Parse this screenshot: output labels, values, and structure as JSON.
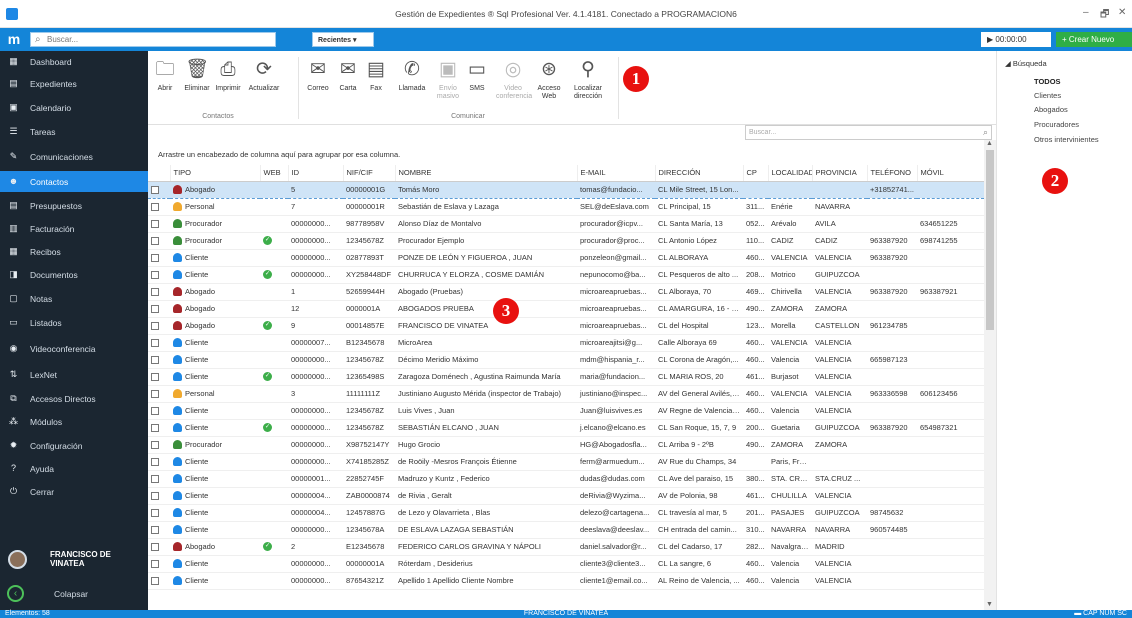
{
  "window": {
    "title": "Gestión de Expedientes ® Sql Profesional Ver. 4.1.4181. Conectado a PROGRAMACION6",
    "min": "–",
    "max": "🗗",
    "close": "✕"
  },
  "topbar": {
    "search_placeholder": "Buscar...",
    "recent_label": "Recientes",
    "timer": "▶ 00:00:00",
    "create_label": "+ Crear Nuevo"
  },
  "sidebar": {
    "items": [
      {
        "label": "Dashboard",
        "icon": "▦"
      },
      {
        "label": "Expedientes",
        "icon": "▤"
      },
      {
        "label": "Calendario",
        "icon": "▣"
      },
      {
        "label": "Tareas",
        "icon": "☰"
      },
      {
        "label": "Comunicaciones",
        "icon": "✎"
      },
      {
        "label": "Contactos",
        "icon": "☻"
      },
      {
        "label": "Presupuestos",
        "icon": "▤"
      },
      {
        "label": "Facturación",
        "icon": "▥"
      },
      {
        "label": "Recibos",
        "icon": "▦"
      },
      {
        "label": "Documentos",
        "icon": "◨"
      },
      {
        "label": "Notas",
        "icon": "▢"
      },
      {
        "label": "Listados",
        "icon": "▭"
      },
      {
        "label": "Videoconferencia",
        "icon": "◉"
      },
      {
        "label": "LexNet",
        "icon": "⇅"
      },
      {
        "label": "Accesos Directos",
        "icon": "⧉"
      },
      {
        "label": "Módulos",
        "icon": "⁂"
      },
      {
        "label": "Configuración",
        "icon": "✹"
      },
      {
        "label": "Ayuda",
        "icon": "?"
      },
      {
        "label": "Cerrar",
        "icon": "⏻"
      }
    ],
    "active_index": 5,
    "user_name": "FRANCISCO DE VINATEA",
    "collapse_label": "Colapsar"
  },
  "ribbon": {
    "contactos_buttons": [
      {
        "label": "Abrir",
        "icon": "🗀"
      },
      {
        "label": "Eliminar",
        "icon": "🗑"
      },
      {
        "label": "Imprimir",
        "icon": "⎙"
      },
      {
        "label": "Actualizar",
        "icon": "⟳"
      }
    ],
    "contactos_group": "Contactos",
    "comunicar_buttons": [
      {
        "label": "Correo",
        "icon": "✉",
        "disabled": false
      },
      {
        "label": "Carta",
        "icon": "✉",
        "disabled": false
      },
      {
        "label": "Fax",
        "icon": "▤",
        "disabled": false
      },
      {
        "label": "Llamada",
        "icon": "✆",
        "disabled": false
      },
      {
        "label": "Envío masivo",
        "icon": "▣",
        "disabled": true
      },
      {
        "label": "SMS",
        "icon": "▭",
        "disabled": false
      },
      {
        "label": "Video conferencia",
        "icon": "◎",
        "disabled": true
      },
      {
        "label": "Acceso Web",
        "icon": "⊛",
        "disabled": false
      },
      {
        "label": "Localizar dirección",
        "icon": "⚲",
        "disabled": false
      }
    ],
    "comunicar_group": "Comunicar"
  },
  "annotations": [
    "1",
    "2",
    "3"
  ],
  "grid": {
    "search_placeholder": "Buscar...",
    "group_hint": "Arrastre un encabezado de columna aquí para agrupar por esa columna.",
    "columns": [
      "TIPO",
      "WEB",
      "ID",
      "NIF/CIF",
      "NOMBRE",
      "E-MAIL",
      "DIRECCIÓN",
      "CP",
      "LOCALIDAD",
      "PROVINCIA",
      "TELÉFONO",
      "MÓVIL"
    ],
    "rows": [
      {
        "tipo": "Abogado",
        "web": false,
        "id": "5",
        "nif": "00000001G",
        "nombre": "Tomás Moro",
        "email": "tomas@fundacio...",
        "dir": "CL Mile Street, 15 Lon...",
        "cp": "",
        "loc": "",
        "prov": "",
        "tel": "+31852741...",
        "movil": ""
      },
      {
        "tipo": "Personal",
        "web": false,
        "id": "7",
        "nif": "00000001R",
        "nombre": "Sebastián de Eslava y Lazaga",
        "email": "SEL@deEslava.com",
        "dir": "CL Principal, 15",
        "cp": "311...",
        "loc": "Enérie",
        "prov": "NAVARRA",
        "tel": "",
        "movil": ""
      },
      {
        "tipo": "Procurador",
        "web": false,
        "id": "00000000...",
        "nif": "98778958V",
        "nombre": "Alonso Díaz de Montalvo",
        "email": "procurador@icpv...",
        "dir": "CL Santa María, 13",
        "cp": "052...",
        "loc": "Arévalo",
        "prov": "AVILA",
        "tel": "",
        "movil": "634651225"
      },
      {
        "tipo": "Procurador",
        "web": true,
        "id": "00000000...",
        "nif": "12345678Z",
        "nombre": "Procurador Ejemplo",
        "email": "procurador@proc...",
        "dir": "CL Antonio López",
        "cp": "110...",
        "loc": "CADIZ",
        "prov": "CADIZ",
        "tel": "963387920",
        "movil": "698741255"
      },
      {
        "tipo": "Cliente",
        "web": false,
        "id": "00000000...",
        "nif": "02877893T",
        "nombre": "PONZE DE LEÓN Y FIGUEROA , JUAN",
        "email": "ponzeleon@gmail...",
        "dir": "CL ALBORAYA",
        "cp": "460...",
        "loc": "VALENCIA",
        "prov": "VALENCIA",
        "tel": "963387920",
        "movil": ""
      },
      {
        "tipo": "Cliente",
        "web": true,
        "id": "00000000...",
        "nif": "XY258448DF",
        "nombre": "CHURRUCA Y ELORZA , COSME DAMIÁN",
        "email": "nepunocomo@ba...",
        "dir": "CL Pesqueros de alto ...",
        "cp": "208...",
        "loc": "Motrico",
        "prov": "GUIPUZCOA",
        "tel": "",
        "movil": ""
      },
      {
        "tipo": "Abogado",
        "web": false,
        "id": "1",
        "nif": "52659944H",
        "nombre": "Abogado (Pruebas)",
        "email": "microareapruebas...",
        "dir": "CL Alboraya, 70",
        "cp": "469...",
        "loc": "Chirivella",
        "prov": "VALENCIA",
        "tel": "963387920",
        "movil": "963387921"
      },
      {
        "tipo": "Abogado",
        "web": false,
        "id": "12",
        "nif": "0000001A",
        "nombre": "ABOGADOS PRUEBA",
        "email": "microareapruebas...",
        "dir": "CL AMARGURA, 16 - 1...",
        "cp": "490...",
        "loc": "ZAMORA",
        "prov": "ZAMORA",
        "tel": "",
        "movil": ""
      },
      {
        "tipo": "Abogado",
        "web": true,
        "id": "9",
        "nif": "00014857E",
        "nombre": "FRANCISCO DE VINATEA",
        "email": "microareapruebas...",
        "dir": "CL del Hospital",
        "cp": "123...",
        "loc": "Morella",
        "prov": "CASTELLON",
        "tel": "961234785",
        "movil": ""
      },
      {
        "tipo": "Cliente",
        "web": false,
        "id": "00000007...",
        "nif": "B12345678",
        "nombre": "MicroArea",
        "email": "microareajitsi@g...",
        "dir": "Calle Alboraya 69",
        "cp": "460...",
        "loc": "VALENCIA",
        "prov": "VALENCIA",
        "tel": "",
        "movil": ""
      },
      {
        "tipo": "Cliente",
        "web": false,
        "id": "00000000...",
        "nif": "12345678Z",
        "nombre": "Décimo Meridio Máximo",
        "email": "mdm@hispania_r...",
        "dir": "CL Corona de Aragón,...",
        "cp": "460...",
        "loc": "Valencia",
        "prov": "VALENCIA",
        "tel": "665987123",
        "movil": ""
      },
      {
        "tipo": "Cliente",
        "web": true,
        "id": "00000000...",
        "nif": "12365498S",
        "nombre": "Zaragoza Doménech , Agustina Raimunda María",
        "email": "maria@fundacion...",
        "dir": "CL MARIA ROS, 20",
        "cp": "461...",
        "loc": "Burjasot",
        "prov": "VALENCIA",
        "tel": "",
        "movil": ""
      },
      {
        "tipo": "Personal",
        "web": false,
        "id": "3",
        "nif": "11111111Z",
        "nombre": "Justiniano Augusto Mérida (inspector de Trabajo)",
        "email": "justiniano@inspec...",
        "dir": "AV del General Avilés, ...",
        "cp": "460...",
        "loc": "VALENCIA",
        "prov": "VALENCIA",
        "tel": "963336598",
        "movil": "606123456"
      },
      {
        "tipo": "Cliente",
        "web": false,
        "id": "00000000...",
        "nif": "12345678Z",
        "nombre": "Luis Vives , Juan",
        "email": "Juan@luisvives.es",
        "dir": "AV Regne de Valencia, ...",
        "cp": "460...",
        "loc": "Valencia",
        "prov": "VALENCIA",
        "tel": "",
        "movil": ""
      },
      {
        "tipo": "Cliente",
        "web": true,
        "id": "00000000...",
        "nif": "12345678Z",
        "nombre": "SEBASTIÁN ELCANO , JUAN",
        "email": "j.elcano@elcano.es",
        "dir": "CL San Roque, 15, 7, 9",
        "cp": "200...",
        "loc": "Guetaria",
        "prov": "GUIPUZCOA",
        "tel": "963387920",
        "movil": "654987321"
      },
      {
        "tipo": "Procurador",
        "web": false,
        "id": "00000000...",
        "nif": "X98752147Y",
        "nombre": "Hugo Grocio",
        "email": "HG@Abogadosfla...",
        "dir": "CL Arriba 9 - 2ºB",
        "cp": "490...",
        "loc": "ZAMORA",
        "prov": "ZAMORA",
        "tel": "",
        "movil": ""
      },
      {
        "tipo": "Cliente",
        "web": false,
        "id": "00000000...",
        "nif": "X74185285Z",
        "nombre": "de Roöily -Mesros François Étienne",
        "email": "ferm@armuedum...",
        "dir": "AV Rue du Champs, 34",
        "cp": "",
        "loc": "Paris, Fran...",
        "prov": "",
        "tel": "",
        "movil": ""
      },
      {
        "tipo": "Cliente",
        "web": false,
        "id": "00000001...",
        "nif": "22852745F",
        "nombre": "Madruzo y Kuntz , Federico",
        "email": "dudas@dudas.com",
        "dir": "CL Ave del paraiso, 15",
        "cp": "380...",
        "loc": "STA. CRUZ...",
        "prov": "STA.CRUZ ...",
        "tel": "",
        "movil": ""
      },
      {
        "tipo": "Cliente",
        "web": false,
        "id": "00000004...",
        "nif": "ZAB0000874",
        "nombre": "de Rivia , Geralt",
        "email": "deRivia@Wyzima...",
        "dir": "AV de Polonia, 98",
        "cp": "461...",
        "loc": "CHULILLA",
        "prov": "VALENCIA",
        "tel": "",
        "movil": ""
      },
      {
        "tipo": "Cliente",
        "web": false,
        "id": "00000004...",
        "nif": "12457887G",
        "nombre": "de Lezo y Olavarrieta , Blas",
        "email": "delezo@cartagena...",
        "dir": "CL travesía al mar, 5",
        "cp": "201...",
        "loc": "PASAJES",
        "prov": "GUIPUZCOA",
        "tel": "98745632",
        "movil": ""
      },
      {
        "tipo": "Cliente",
        "web": false,
        "id": "00000000...",
        "nif": "12345678A",
        "nombre": "DE ESLAVA LAZAGA SEBASTIÁN",
        "email": "deeslava@deeslav...",
        "dir": "CH entrada del camin...",
        "cp": "310...",
        "loc": "NAVARRA",
        "prov": "NAVARRA",
        "tel": "960574485",
        "movil": ""
      },
      {
        "tipo": "Abogado",
        "web": true,
        "id": "2",
        "nif": "E12345678",
        "nombre": "FEDERICO CARLOS GRAVINA Y NÁPOLI",
        "email": "daniel.salvador@r...",
        "dir": "CL del Cadarso, 17",
        "cp": "282...",
        "loc": "Navalgrande",
        "prov": "MADRID",
        "tel": "",
        "movil": ""
      },
      {
        "tipo": "Cliente",
        "web": false,
        "id": "00000000...",
        "nif": "00000001A",
        "nombre": "Róterdam , Desiderius",
        "email": "cliente3@cliente3...",
        "dir": "CL La sangre, 6",
        "cp": "460...",
        "loc": "Valencia",
        "prov": "VALENCIA",
        "tel": "",
        "movil": ""
      },
      {
        "tipo": "Cliente",
        "web": false,
        "id": "00000000...",
        "nif": "87654321Z",
        "nombre": "Apellido 1 Apellido Cliente Nombre",
        "email": "cliente1@email.co...",
        "dir": "AL Reino de Valencia, ...",
        "cp": "460...",
        "loc": "Valencia",
        "prov": "VALENCIA",
        "tel": "",
        "movil": ""
      }
    ],
    "selected_index": 0
  },
  "right_panel": {
    "root": "◢ Búsqueda",
    "items": [
      "TODOS",
      "Clientes",
      "Abogados",
      "Procuradores",
      "Otros intervinientes"
    ],
    "selected_index": 0
  },
  "status": {
    "left": "Elementos: 58",
    "center": "FRANCISCO DE VINATEA",
    "right": "▬  CAP  NUM  SC"
  },
  "colors": {
    "topbar": "#1485d8",
    "sidebar": "#1b2631",
    "active": "#1e88e5",
    "create": "#2fae46",
    "badge": "#e8110f",
    "tipo": {
      "Abogado": "#a6262a",
      "Personal": "#f0a92e",
      "Procurador": "#3a8e3a",
      "Cliente": "#1e88e5"
    }
  }
}
